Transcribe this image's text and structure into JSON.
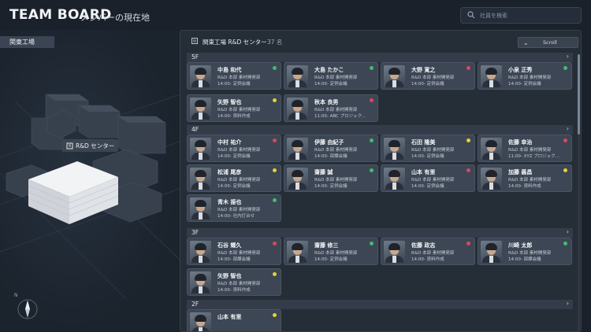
{
  "header": {
    "title": "TEAM BOARD",
    "subtitle": "メンバーの現在地",
    "search_placeholder": "社員を検索"
  },
  "left": {
    "location_tab": "関東工場",
    "building_label": "R&D センター",
    "compass_label": "N"
  },
  "panel": {
    "title": "関東工場 R&D センター",
    "count": "37 名",
    "scroll_label": "Scroll"
  },
  "status_colors": {
    "green": "#3fbf6a",
    "red": "#e0445a",
    "yellow": "#e8d030"
  },
  "floors": [
    {
      "label": "5F",
      "members": [
        {
          "name": "中島 和代",
          "dept": "R&D 本部 素材開発部",
          "sched": "14:00-  定例会議",
          "status": "green"
        },
        {
          "name": "大島 たかこ",
          "dept": "R&D 本部 素材開発部",
          "sched": "14:00-  定例会議",
          "status": "green"
        },
        {
          "name": "大野 寛之",
          "dept": "R&D 本部 素材開発部",
          "sched": "14:00-  定例会議",
          "status": "red"
        },
        {
          "name": "小泉 正秀",
          "dept": "R&D 本部 素材開発部",
          "sched": "14:00-  定例会議",
          "status": "green"
        },
        {
          "name": "矢野 智也",
          "dept": "R&D 本部 素材開発部",
          "sched": "14:00-  資料作成",
          "status": "yellow"
        },
        {
          "name": "秋本 良男",
          "dept": "R&D 本部 素材開発部",
          "sched": "11:00-  ABC プロジェク…",
          "status": "red"
        }
      ]
    },
    {
      "label": "4F",
      "members": [
        {
          "name": "中村 祐介",
          "dept": "R&D 本部 素材開発部",
          "sched": "14:00-  定例会議",
          "status": "red"
        },
        {
          "name": "伊藤 由紀子",
          "dept": "R&D 本部 素材開発部",
          "sched": "14:00-  部課会議",
          "status": "green"
        },
        {
          "name": "石田 隆美",
          "dept": "R&D 本部 素材開発部",
          "sched": "14:00-  定例会議",
          "status": "yellow"
        },
        {
          "name": "佐藤 幸治",
          "dept": "R&D 本部 素材開発部",
          "sched": "11:00-  XYZ プロジェク…",
          "status": "red"
        },
        {
          "name": "松浦 尾彦",
          "dept": "R&D 本部 素材開発部",
          "sched": "14:00-  定例会議",
          "status": "yellow"
        },
        {
          "name": "齋藤 誠",
          "dept": "R&D 本部 素材開発部",
          "sched": "14:00-  定例会議",
          "status": "green"
        },
        {
          "name": "山本 有里",
          "dept": "R&D 本部 素材開発部",
          "sched": "14:00-  定例会議",
          "status": "red"
        },
        {
          "name": "加藤 義昌",
          "dept": "R&D 本部 素材開発部",
          "sched": "14:00-  資料作成",
          "status": "yellow"
        },
        {
          "name": "青木 振也",
          "dept": "R&D 本部 素材開発部",
          "sched": "14:00-  社内打合せ",
          "status": "green"
        }
      ]
    },
    {
      "label": "3F",
      "members": [
        {
          "name": "石谷 耀久",
          "dept": "R&D 本部 素材開発部",
          "sched": "14:00-  部課会議",
          "status": "red"
        },
        {
          "name": "齋藤 修三",
          "dept": "R&D 本部 素材開発部",
          "sched": "14:00-  定例会議",
          "status": "green"
        },
        {
          "name": "佐藤 政志",
          "dept": "R&D 本部 素材開発部",
          "sched": "14:00-  資料作成",
          "status": "red"
        },
        {
          "name": "川崎 太郎",
          "dept": "R&D 本部 素材開発部",
          "sched": "14:00-  部課会議",
          "status": "green"
        },
        {
          "name": "矢野 智也",
          "dept": "R&D 本部 素材開発部",
          "sched": "14:00-  資料作成",
          "status": "yellow"
        }
      ]
    },
    {
      "label": "2F",
      "members": [
        {
          "name": "山本 有里",
          "dept": "",
          "sched": "",
          "status": "yellow"
        }
      ]
    }
  ]
}
